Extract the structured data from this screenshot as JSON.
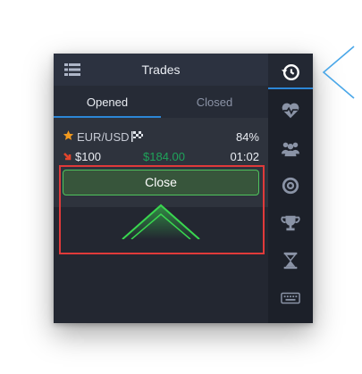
{
  "header": {
    "title": "Trades",
    "menu_icon": "list-menu-icon"
  },
  "tabs": [
    {
      "label": "Opened",
      "active": true
    },
    {
      "label": "Closed",
      "active": false
    }
  ],
  "trade": {
    "pair": "EUR/USD",
    "payout": "84%",
    "amount": "$100",
    "profit": "$184.00",
    "time_left": "01:02",
    "direction": "down"
  },
  "close_button": {
    "label": "Close"
  },
  "sidebar": [
    {
      "icon": "trade-history-icon",
      "active": true
    },
    {
      "icon": "heart-pulse-icon",
      "active": false
    },
    {
      "icon": "community-users-icon",
      "active": false
    },
    {
      "icon": "target-icon",
      "active": false
    },
    {
      "icon": "trophy-icon",
      "active": false
    },
    {
      "icon": "hourglass-icon",
      "active": false
    },
    {
      "icon": "keyboard-icon",
      "active": false
    }
  ],
  "colors": {
    "accent_blue": "#2c86d6",
    "profit_green": "#1fa35a",
    "close_border": "#4fc45d",
    "highlight_red": "#e03a3a",
    "star_orange": "#f29a1f",
    "arrow_red": "#e2452c"
  }
}
